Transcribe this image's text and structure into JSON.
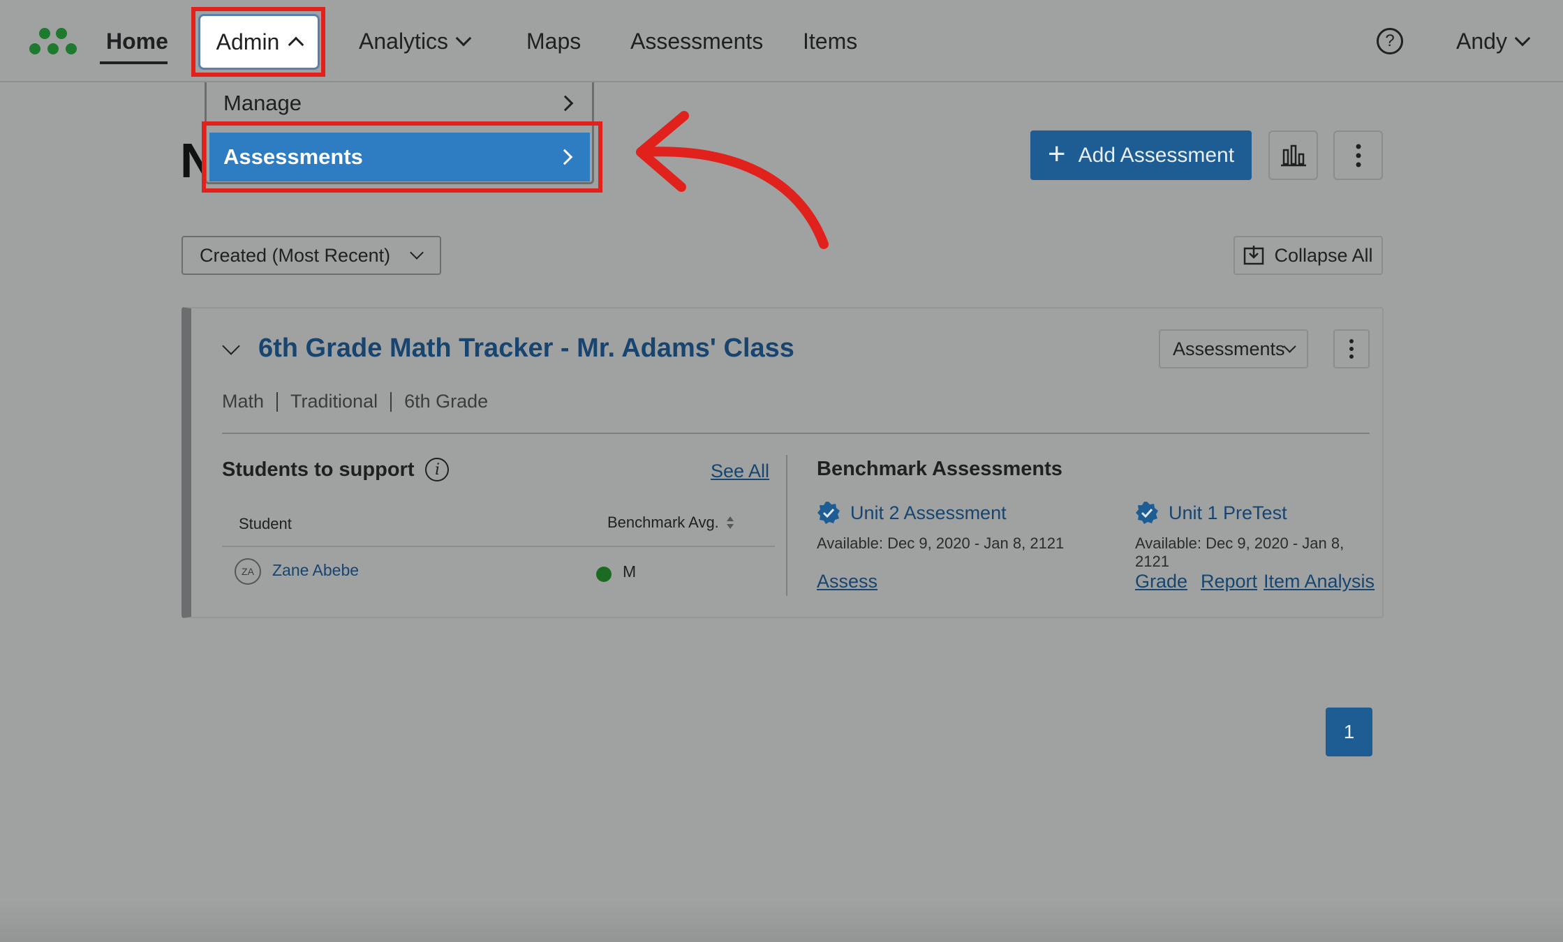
{
  "nav": {
    "home": "Home",
    "admin": "Admin",
    "analytics": "Analytics",
    "maps": "Maps",
    "assessments": "Assessments",
    "items": "Items",
    "help": "?",
    "user": "Andy"
  },
  "admin_menu": {
    "manage": "Manage",
    "assessments": "Assessments"
  },
  "page": {
    "title_partial": "N",
    "add_button": "Add Assessment",
    "sort_value": "Created (Most Recent)",
    "collapse_all": "Collapse All"
  },
  "tracker": {
    "title": "6th Grade Math Tracker - Mr. Adams' Class",
    "meta": [
      "Math",
      "Traditional",
      "6th Grade"
    ],
    "view_select": "Assessments",
    "students_title": "Students to support",
    "see_all": "See All",
    "col_student": "Student",
    "col_benchmark": "Benchmark Avg.",
    "students": [
      {
        "initials": "ZA",
        "name": "Zane Abebe",
        "mark": "M"
      }
    ],
    "benchmark_title": "Benchmark Assessments",
    "benchmarks": [
      {
        "name": "Unit 2 Assessment",
        "available": "Available: Dec 9, 2020 - Jan 8, 2121",
        "actions": [
          "Assess"
        ]
      },
      {
        "name": "Unit 1 PreTest",
        "available": "Available: Dec 9, 2020 - Jan 8, 2121",
        "actions": [
          "Grade",
          "Report",
          "Item Analysis"
        ]
      }
    ]
  },
  "pagination": {
    "current": "1"
  },
  "colors": {
    "overlay_bg": "#a0a2a2",
    "primary": "#1d5d94",
    "highlight": "#2e7cc1",
    "annotation_red": "#e1221c",
    "link": "#17456f",
    "status_green": "#1b6b22",
    "logo_green": "#1e7a2e"
  }
}
